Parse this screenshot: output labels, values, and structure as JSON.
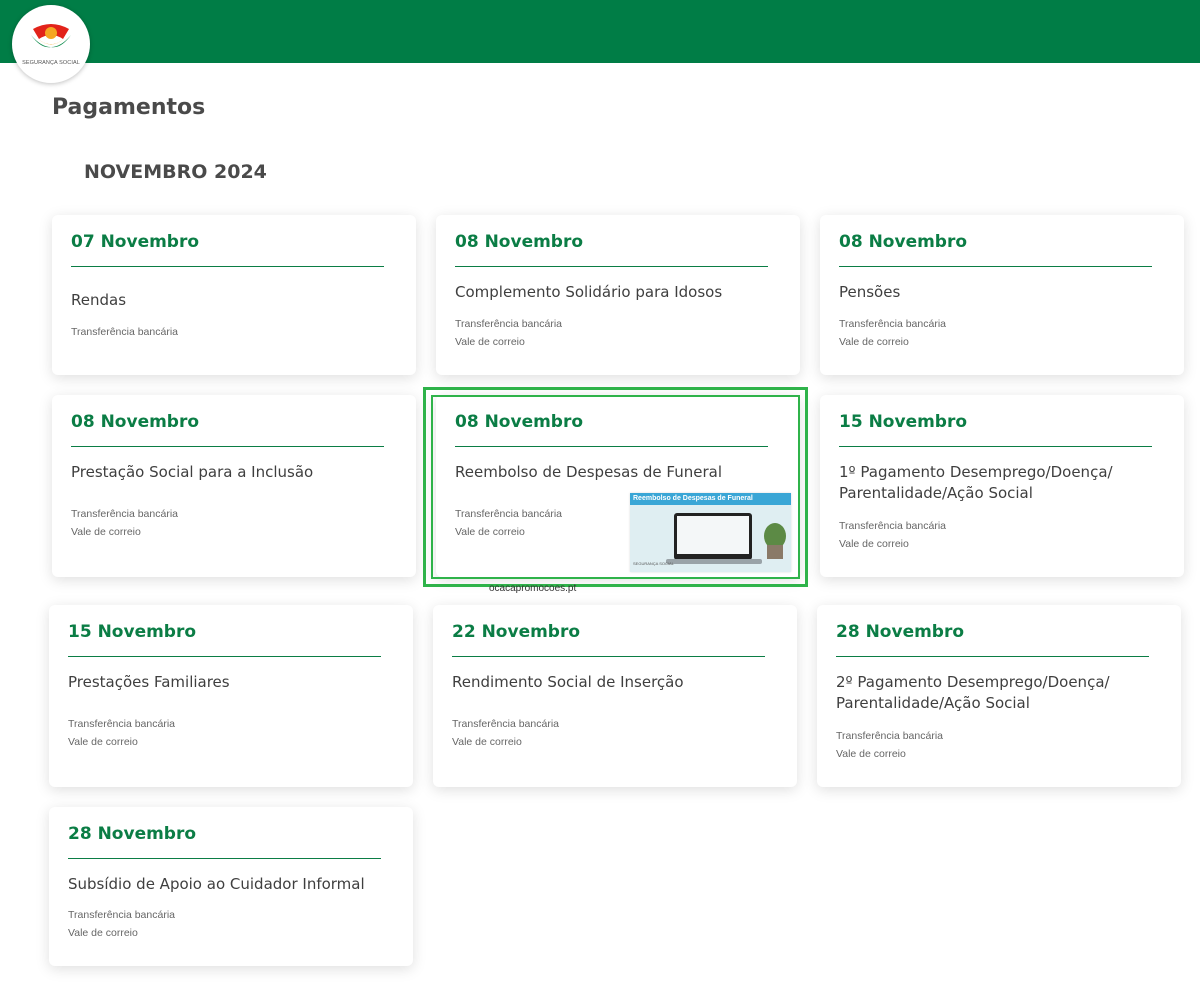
{
  "header": {
    "logo_text": "SEGURANÇA SOCIAL",
    "brand_color": "#007d46",
    "accent_color": "#0b7d45",
    "highlight_color": "#2fb34a"
  },
  "page": {
    "title": "Pagamentos",
    "month": "NOVEMBRO 2024"
  },
  "cards": [
    {
      "date": "07 Novembro",
      "title": "Rendas",
      "methods": [
        "Transferência bancária"
      ]
    },
    {
      "date": "08 Novembro",
      "title": "Complemento Solidário para Idosos",
      "methods": [
        "Transferência bancária",
        "Vale de correio"
      ]
    },
    {
      "date": "08 Novembro",
      "title": "Pensões",
      "methods": [
        "Transferência bancária",
        "Vale de correio"
      ]
    },
    {
      "date": "08 Novembro",
      "title": "Prestação Social para a Inclusão",
      "methods": [
        "Transferência bancária",
        "Vale de correio"
      ]
    },
    {
      "date": "08 Novembro",
      "title": "Reembolso de Despesas de Funeral",
      "methods": [
        "Transferência bancária",
        "Vale de correio"
      ]
    },
    {
      "date": "15 Novembro",
      "title": "1º Pagamento Desemprego/Doença/ Parentalidade/Ação Social",
      "methods": [
        "Transferência bancária",
        "Vale de correio"
      ]
    },
    {
      "date": "15 Novembro",
      "title": "Prestações Familiares",
      "methods": [
        "Transferência bancária",
        "Vale de correio"
      ]
    },
    {
      "date": "22 Novembro",
      "title": "Rendimento Social de Inserção",
      "methods": [
        "Transferência bancária",
        "Vale de correio"
      ]
    },
    {
      "date": "28 Novembro",
      "title": "2º Pagamento Desemprego/Doença/ Parentalidade/Ação Social",
      "methods": [
        "Transferência bancária",
        "Vale de correio"
      ]
    },
    {
      "date": "28 Novembro",
      "title": "Subsídio de Apoio ao Cuidador Informal",
      "methods": [
        "Transferência bancária",
        "Vale de correio"
      ]
    }
  ],
  "ad": {
    "banner": "Reembolso de Despesas de Funeral",
    "source": "ocacapromocoes.pt"
  }
}
